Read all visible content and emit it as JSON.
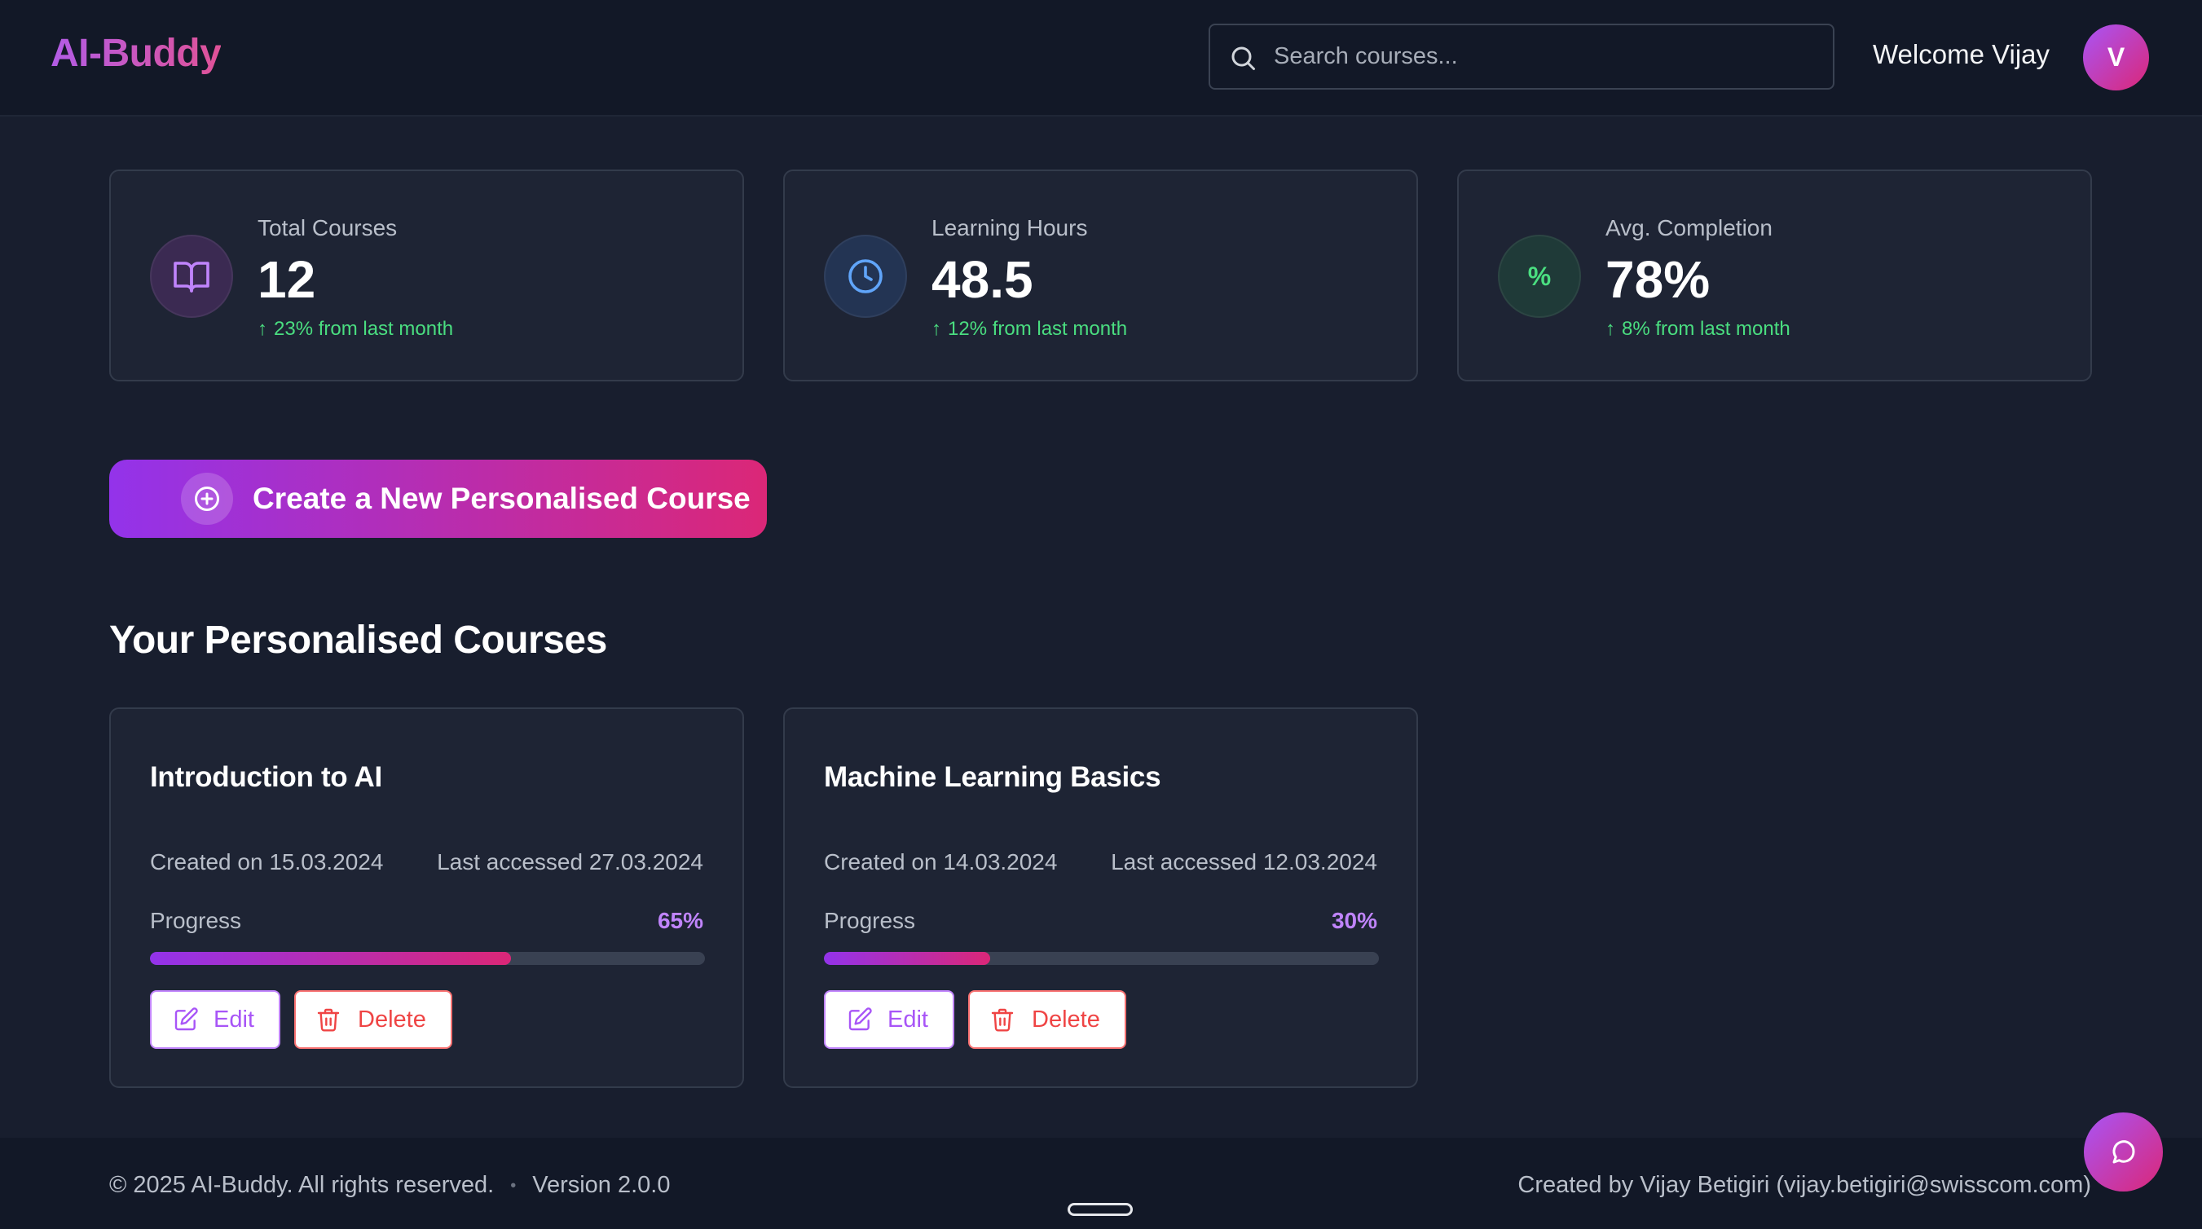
{
  "header": {
    "logo": "AI-Buddy",
    "search_placeholder": "Search courses...",
    "welcome": "Welcome Vijay",
    "avatar_initial": "V"
  },
  "stats": [
    {
      "label": "Total Courses",
      "value": "12",
      "trend": "23% from last month",
      "icon": "book-open-icon",
      "accent": "#c084fc"
    },
    {
      "label": "Learning Hours",
      "value": "48.5",
      "trend": "12% from last month",
      "icon": "clock-icon",
      "accent": "#60a5fa"
    },
    {
      "label": "Avg. Completion",
      "value": "78%",
      "trend": "8% from last month",
      "icon": "percent-icon",
      "icon_text": "%",
      "accent": "#4ade80"
    }
  ],
  "create_button": {
    "label": "Create a New Personalised Course",
    "icon": "plus-circle-icon"
  },
  "courses_section": {
    "title": "Your Personalised Courses"
  },
  "courses": [
    {
      "title": "Introduction to AI",
      "created": "Created on 15.03.2024",
      "accessed": "Last accessed 27.03.2024",
      "progress_label": "Progress",
      "progress_text": "65%",
      "progress": 0.65,
      "edit_label": "Edit",
      "delete_label": "Delete"
    },
    {
      "title": "Machine Learning Basics",
      "created": "Created on 14.03.2024",
      "accessed": "Last accessed 12.03.2024",
      "progress_label": "Progress",
      "progress_text": "30%",
      "progress": 0.3,
      "edit_label": "Edit",
      "delete_label": "Delete"
    }
  ],
  "footer": {
    "copyright": "© 2025 AI-Buddy. All rights reserved.",
    "separator": "•",
    "version": "Version 2.0.0",
    "credit": "Created by Vijay Betigiri (vijay.betigiri@swisscom.com)"
  },
  "colors": {
    "background": "#181e2e",
    "header_bg": "#121827",
    "card_bg": "#1e2434",
    "brand_gradient_start": "#9333ea",
    "brand_gradient_end": "#db2777",
    "trend_positive": "#4ade80"
  }
}
